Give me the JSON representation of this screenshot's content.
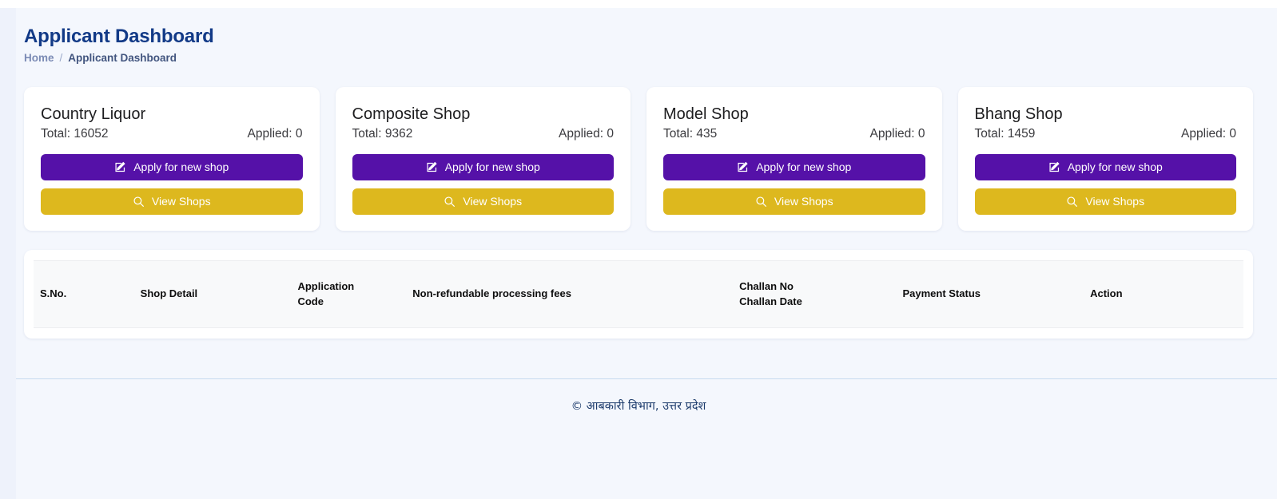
{
  "header": {
    "title": "Applicant Dashboard",
    "breadcrumb": {
      "home": "Home",
      "separator": "/",
      "current": "Applicant Dashboard"
    }
  },
  "cards": [
    {
      "title": "Country Liquor",
      "total": "Total: 16052",
      "applied": "Applied: 0",
      "apply_label": "Apply for new shop",
      "view_label": "View Shops"
    },
    {
      "title": "Composite Shop",
      "total": "Total: 9362",
      "applied": "Applied: 0",
      "apply_label": "Apply for new shop",
      "view_label": "View Shops"
    },
    {
      "title": "Model Shop",
      "total": "Total: 435",
      "applied": "Applied: 0",
      "apply_label": "Apply for new shop",
      "view_label": "View Shops"
    },
    {
      "title": "Bhang Shop",
      "total": "Total: 1459",
      "applied": "Applied: 0",
      "apply_label": "Apply for new shop",
      "view_label": "View Shops"
    }
  ],
  "table": {
    "columns": {
      "sno": "S.No.",
      "shop_detail": "Shop Detail",
      "application_code_line1": "Application",
      "application_code_line2": "Code",
      "fees": "Non-refundable processing fees",
      "challan_line1": "Challan No",
      "challan_line2": "Challan Date",
      "payment_status": "Payment Status",
      "action": "Action"
    },
    "rows": []
  },
  "footer": {
    "text": "© आबकारी विभाग, उत्तर प्रदेश"
  },
  "icons": {
    "apply": "pencil-square-icon",
    "view": "search-icon"
  },
  "colors": {
    "title": "#123a87",
    "apply_button": "#5511a8",
    "view_button": "#ddb81e",
    "page_background": "#f4f7fd"
  }
}
